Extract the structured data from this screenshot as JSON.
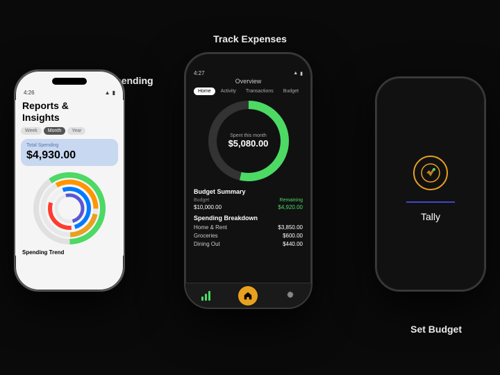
{
  "labels": {
    "analyze": "Analyze Spending",
    "track": "Track Expenses",
    "budget": "Set Budget"
  },
  "phone_left": {
    "status_time": "4:26",
    "title_line1": "Reports &",
    "title_line2": "Insights",
    "tabs": [
      "Week",
      "Month",
      "Year"
    ],
    "active_tab": "Month",
    "spending_label": "Total Spending",
    "spending_amount": "$4,930.00",
    "spending_trend": "Spending Trend",
    "donut": {
      "segments": [
        {
          "color": "#4cd964",
          "value": 35
        },
        {
          "color": "#ff3b30",
          "value": 15
        },
        {
          "color": "#007aff",
          "value": 20
        },
        {
          "color": "#ff9500",
          "value": 10
        },
        {
          "color": "#e8a020",
          "value": 8
        },
        {
          "color": "#5856d6",
          "value": 12
        }
      ]
    }
  },
  "phone_middle": {
    "status_time": "4:27",
    "screen_title": "Overview",
    "nav_tabs": [
      "Home",
      "Activity",
      "Transactions",
      "Budget"
    ],
    "active_tab": "Home",
    "gauge_label": "Spent this month",
    "gauge_amount": "$5,080.00",
    "budget_summary_title": "Budget Summary",
    "budget_label": "Budget",
    "budget_amount": "$10,000.00",
    "remaining_label": "Remaining",
    "remaining_amount": "$4,920.00",
    "breakdown_title": "Spending Breakdown",
    "breakdown_items": [
      {
        "category": "Home & Rent",
        "amount": "$3,850.00"
      },
      {
        "category": "Groceries",
        "amount": "$600.00"
      },
      {
        "category": "Dining Out",
        "amount": "$440.00"
      }
    ],
    "bottom_nav": [
      "chart-bar",
      "home",
      "gear"
    ]
  },
  "phone_right": {
    "logo_char": "✕",
    "app_name": "Tally"
  }
}
